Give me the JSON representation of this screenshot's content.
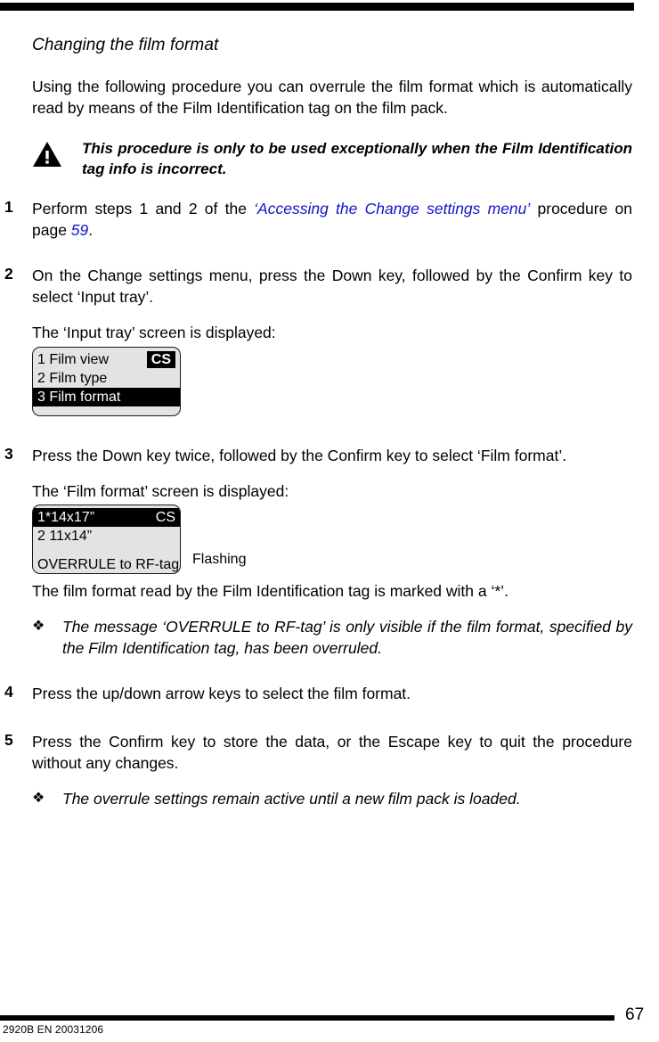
{
  "document": {
    "heading": "Changing the film format",
    "intro": "Using the following procedure you can overrule the film format which is automatically read by means of the Film Identification tag on the film pack.",
    "warning": {
      "icon": "warning-triangle-icon",
      "text": "This procedure is only to be used exceptionally when the Film Identification tag info is incorrect."
    },
    "steps": [
      {
        "number": "1",
        "text_before": "Perform steps 1 and 2 of the ",
        "link_text": "‘Accessing the Change settings menu’",
        "text_middle": " procedure on page ",
        "page_ref": "59",
        "text_after": "."
      },
      {
        "number": "2",
        "text": "On the Change settings menu, press the Down key, followed by the Confirm key to select ‘Input tray’.",
        "sub_text": "The ‘Input tray’ screen is displayed:"
      },
      {
        "number": "3",
        "text": "Press the Down key twice, followed by the Confirm key to select ‘Film format’.",
        "sub_text": "The ‘Film format’ screen is displayed:"
      },
      {
        "number": "4",
        "text": "Press the up/down arrow keys to select the film format."
      },
      {
        "number": "5",
        "text": "Press the Confirm key to store the data, or the Escape key to quit the procedure without any changes."
      }
    ],
    "asterisk_note": "The film format read by the Film Identification tag is marked with a ‘*’.",
    "notes": [
      {
        "bullet": "❖",
        "text": "The message ‘OVERRULE to RF-tag’ is only visible if the film format, specified by the Film Identification tag, has been overruled."
      },
      {
        "bullet": "❖",
        "text": "The overrule settings remain active until a new film pack is loaded."
      }
    ],
    "lcd_screens": [
      {
        "id": "input-tray",
        "badge": "CS",
        "rows": [
          {
            "label": "1 Film view",
            "inverted": false
          },
          {
            "label": "2 Film type",
            "inverted": false
          },
          {
            "label": "3 Film format",
            "inverted": true
          }
        ]
      },
      {
        "id": "film-format",
        "badge": "CS",
        "rows": [
          {
            "label": "1*14x17”",
            "inverted": true
          },
          {
            "label": "2 11x14”",
            "inverted": false
          }
        ],
        "status_line": "OVERRULE to RF-tag",
        "annotation": "Flashing"
      }
    ],
    "footer": {
      "code": "2920B EN 20031206",
      "page_number": "67"
    },
    "colors": {
      "link": "#1414c8",
      "lcd_background": "#e3e3e3",
      "lcd_border": "#1a1a1a",
      "ink": "#000000"
    }
  }
}
